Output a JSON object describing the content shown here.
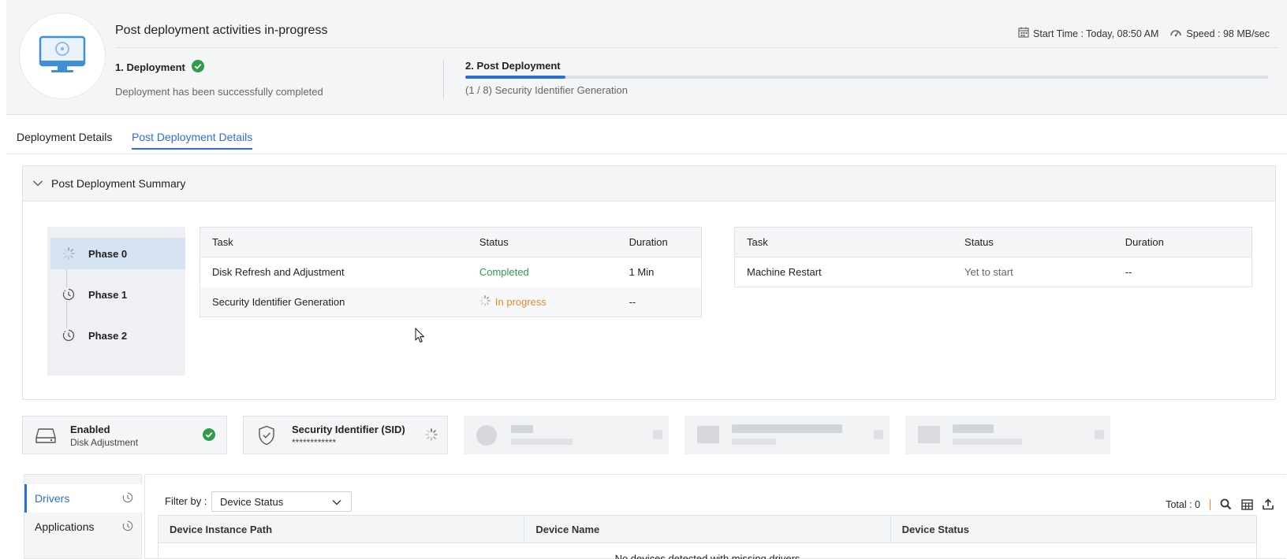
{
  "header": {
    "title": "Post deployment activities in-progress",
    "start_time": "Start Time : Today, 08:50 AM",
    "speed": "Speed : 98 MB/sec",
    "step1": {
      "title": "1. Deployment",
      "subtitle": "Deployment has been successfully completed",
      "status": "completed"
    },
    "step2": {
      "title": "2. Post Deployment",
      "subtitle": "(1 / 8) Security Identifier Generation",
      "progress_fraction": 0.125
    }
  },
  "tabs": [
    {
      "label": "Deployment Details",
      "active": false
    },
    {
      "label": "Post Deployment Details",
      "active": true
    }
  ],
  "summary": {
    "title": "Post Deployment Summary",
    "phases": [
      {
        "label": "Phase 0",
        "state": "in-progress",
        "active": true
      },
      {
        "label": "Phase 1",
        "state": "pending",
        "active": false
      },
      {
        "label": "Phase 2",
        "state": "pending",
        "active": false
      }
    ],
    "columns": [
      "Task",
      "Status",
      "Duration"
    ],
    "table_left": [
      {
        "task": "Disk Refresh and Adjustment",
        "status": "Completed",
        "duration": "1 Min"
      },
      {
        "task": "Security Identifier Generation",
        "status": "In progress",
        "duration": "--"
      }
    ],
    "table_right": [
      {
        "task": "Machine Restart",
        "status": "Yet to start",
        "duration": "--"
      }
    ]
  },
  "cards": [
    {
      "title": "Enabled",
      "subtitle": "Disk Adjustment",
      "icon": "disk-icon",
      "status": "completed"
    },
    {
      "title": "Security Identifier (SID)",
      "subtitle": "************",
      "icon": "shield-icon",
      "status": "in-progress"
    }
  ],
  "left_nav": [
    {
      "label": "Drivers",
      "active": true
    },
    {
      "label": "Applications",
      "active": false
    }
  ],
  "filter": {
    "label": "Filter by :",
    "value": "Device Status"
  },
  "toolbar": {
    "total": "Total : 0"
  },
  "grid": {
    "columns": [
      "Device Instance Path",
      "Device Name",
      "Device Status"
    ],
    "empty_message": "No devices detected with missing drivers"
  },
  "colors": {
    "accent": "#2e6fd6",
    "success": "#2f9b4a",
    "in_progress": "#e88a2d"
  }
}
